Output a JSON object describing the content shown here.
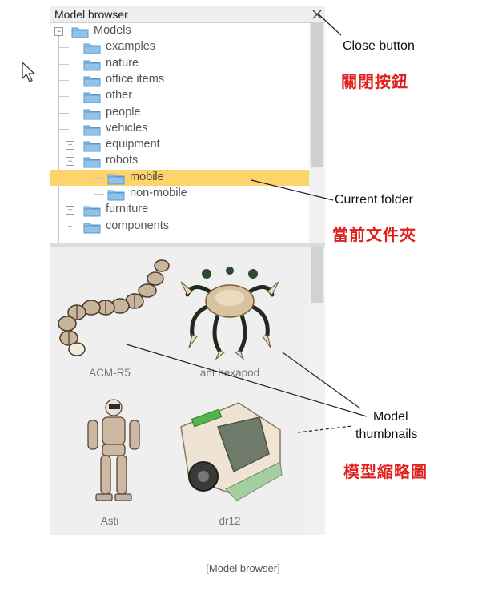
{
  "panel": {
    "title": "Model browser",
    "close_glyph": "✕"
  },
  "tree": {
    "root_label": "Models",
    "items": [
      {
        "label": "examples"
      },
      {
        "label": "nature"
      },
      {
        "label": "office items"
      },
      {
        "label": "other"
      },
      {
        "label": "people"
      },
      {
        "label": "vehicles"
      },
      {
        "label": "equipment",
        "expander": "+"
      },
      {
        "label": "robots",
        "expander": "−"
      },
      {
        "label": "mobile",
        "selected": true
      },
      {
        "label": "non-mobile"
      },
      {
        "label": "furniture",
        "expander": "+"
      },
      {
        "label": "components",
        "expander": "+"
      }
    ],
    "root_expander": "−",
    "folder_color": "#8fc3ea",
    "selected_color": "#fdd36b"
  },
  "thumbnails": [
    {
      "name": "ACM-R5",
      "icon": "snake-robot-icon"
    },
    {
      "name": "ant hexapod",
      "icon": "hexapod-robot-icon"
    },
    {
      "name": "Asti",
      "icon": "humanoid-robot-icon"
    },
    {
      "name": "dr12",
      "icon": "wheeled-robot-icon"
    }
  ],
  "annotations": {
    "close_en": "Close button",
    "close_zh": "關閉按鈕",
    "folder_en": "Current folder",
    "folder_zh": "當前文件夾",
    "thumbs_en_1": "Model",
    "thumbs_en_2": "thumbnails",
    "thumbs_zh": "模型縮略圖",
    "accent_color": "#e0201d"
  },
  "figure_caption": "[Model browser]"
}
